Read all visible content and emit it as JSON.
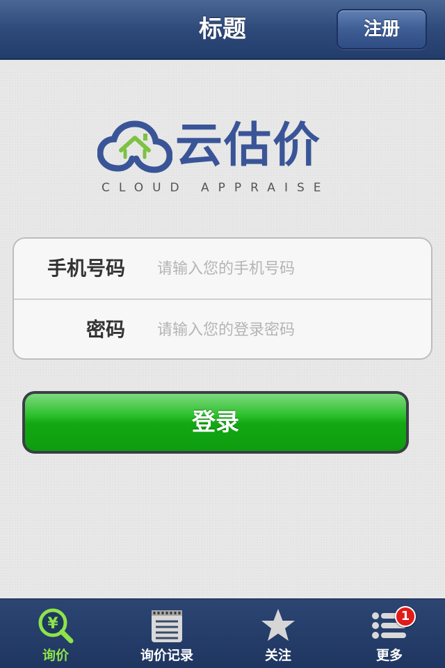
{
  "navbar": {
    "title": "标题",
    "register_label": "注册"
  },
  "logo": {
    "name": "云估价",
    "subtitle": "CLOUD APPRAISE",
    "colors": {
      "primary": "#3a5597",
      "house": "#7dc242"
    }
  },
  "form": {
    "phone": {
      "label": "手机号码",
      "placeholder": "请输入您的手机号码",
      "value": ""
    },
    "password": {
      "label": "密码",
      "placeholder": "请输入您的登录密码",
      "value": ""
    }
  },
  "login": {
    "label": "登录"
  },
  "tabbar": {
    "items": [
      {
        "label": "询价",
        "icon": "price-search-icon",
        "active": true
      },
      {
        "label": "询价记录",
        "icon": "record-list-icon",
        "active": false
      },
      {
        "label": "关注",
        "icon": "star-icon",
        "active": false
      },
      {
        "label": "更多",
        "icon": "more-list-icon",
        "active": false,
        "badge": "1"
      }
    ]
  },
  "colors": {
    "navbar": "#2e4a7a",
    "login_green": "#13a813",
    "tab_active": "#8fe34a"
  }
}
